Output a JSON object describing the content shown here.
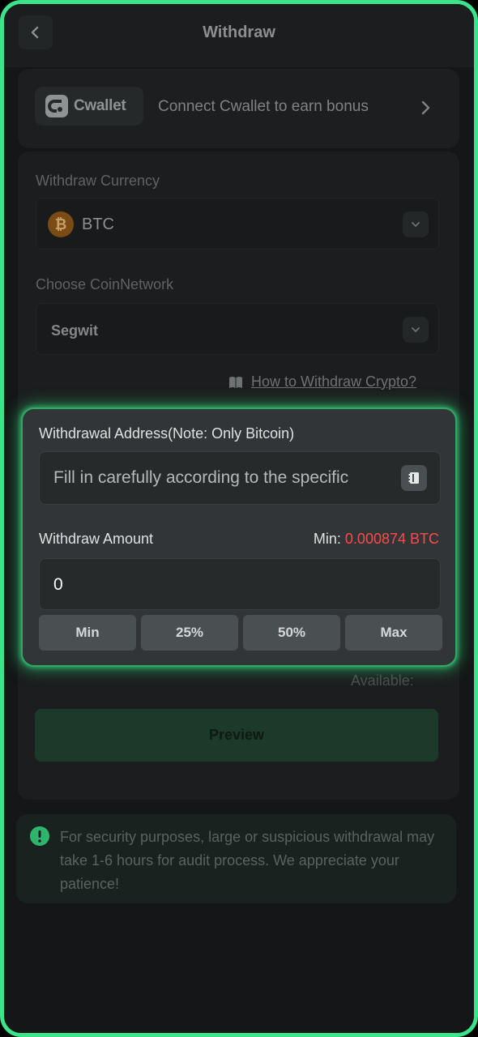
{
  "header": {
    "title": "Withdraw",
    "back_icon": "chevron-left-icon"
  },
  "cwallet": {
    "logo_text": "Cwallet",
    "message": "Connect Cwallet to earn bonus",
    "arrow_icon": "chevron-right-icon"
  },
  "currency": {
    "label": "Withdraw Currency",
    "value": "BTC",
    "coin_icon": "bitcoin-icon"
  },
  "network": {
    "label": "Choose CoinNetwork",
    "value": "Segwit"
  },
  "help": {
    "link": "How to Withdraw Crypto?",
    "icon": "book-icon"
  },
  "modal": {
    "address_label": "Withdrawal Address(Note: Only Bitcoin)",
    "address_placeholder": "Fill in carefully according to the specific",
    "address_book_icon": "address-book-icon",
    "amount_label": "Withdraw Amount",
    "min_label": "Min:",
    "min_value": "0.000874 BTC",
    "amount_value": "0",
    "buttons": [
      "Min",
      "25%",
      "50%",
      "Max"
    ]
  },
  "available_label": "Available:",
  "preview_button": "Preview",
  "notice": {
    "icon": "alert-circle-icon",
    "text": "For security purposes, large or suspicious withdrawal may take 1-6 hours for audit process. We appreciate your patience!"
  },
  "colors": {
    "accent_green": "#3be38a",
    "min_red": "#ff4a4a",
    "bitcoin_orange": "#f7931a"
  }
}
